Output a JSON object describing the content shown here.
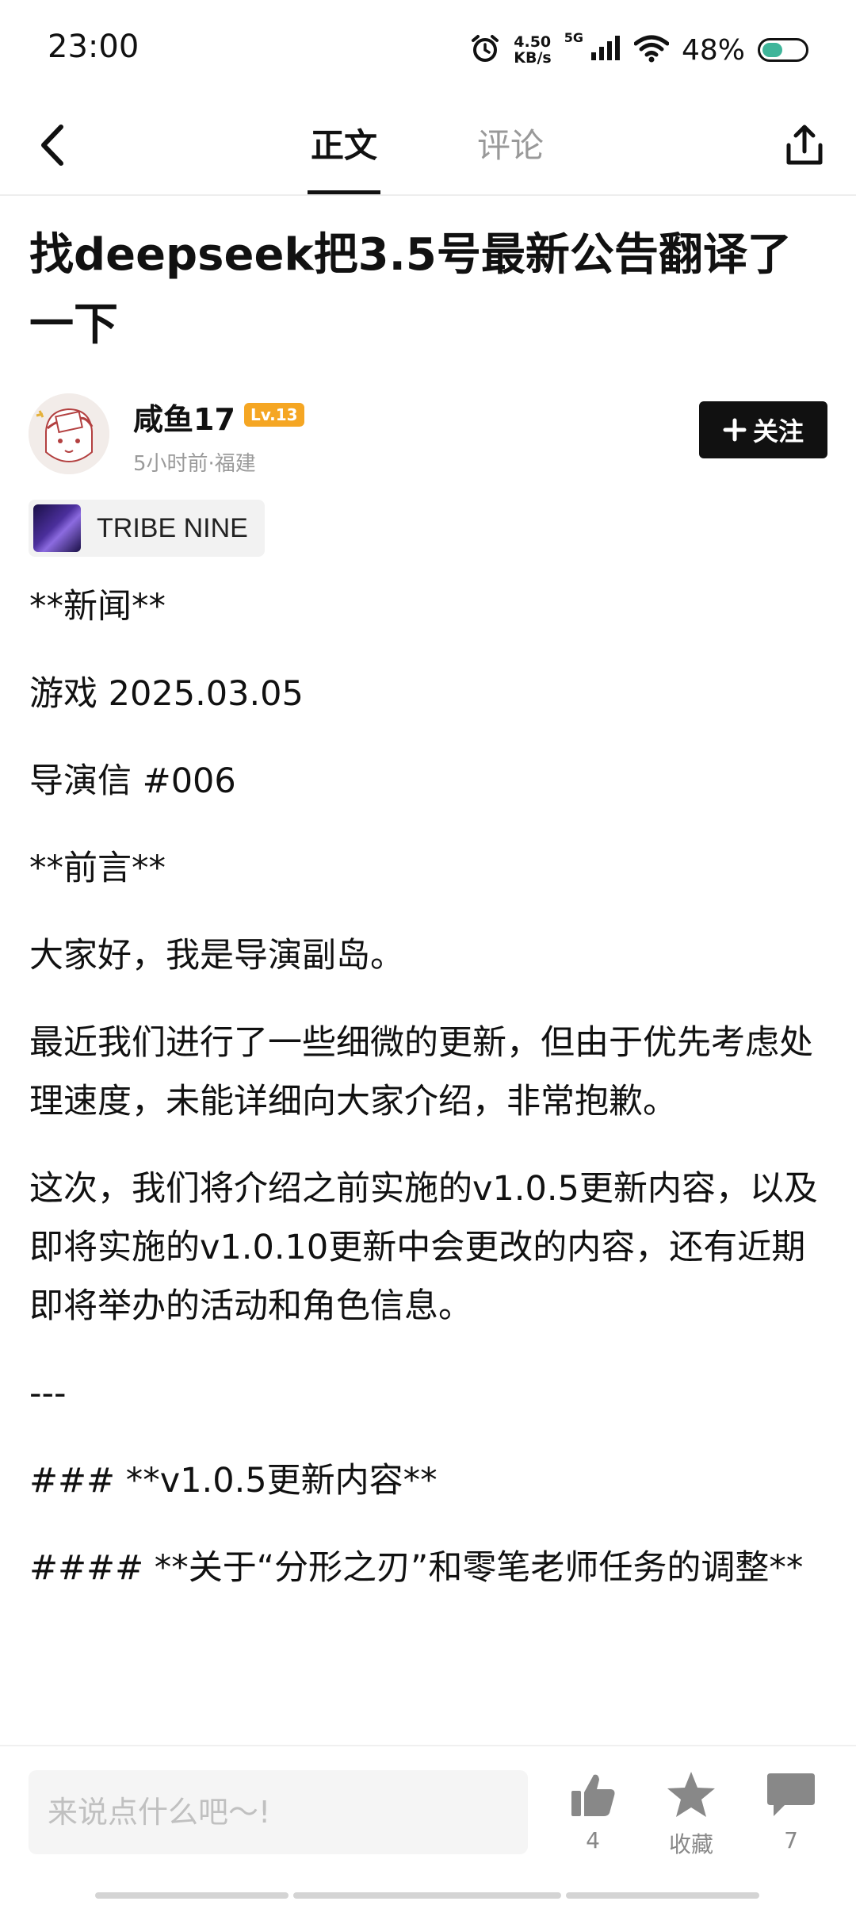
{
  "status": {
    "time": "23:00",
    "speed_value": "4.50",
    "speed_unit": "KB/s",
    "network": "5G",
    "battery": "48%",
    "battery_level": 0.48
  },
  "nav": {
    "tab_article": "正文",
    "tab_comments": "评论",
    "active_tab": "正文"
  },
  "post": {
    "title": "找deepseek把3.5号最新公告翻译了一下",
    "author": {
      "name": "咸鱼17",
      "level": "Lv.13",
      "meta": "5小时前·福建",
      "follow_label": "关注"
    },
    "tag": "TRIBE NINE",
    "paragraphs": [
      "**新闻**",
      "游戏 2025.03.05",
      "导演信 #006",
      "**前言**",
      "大家好，我是导演副岛。",
      "最近我们进行了一些细微的更新，但由于优先考虑处理速度，未能详细向大家介绍，非常抱歉。",
      "这次，我们将介绍之前实施的v1.0.5更新内容，以及即将实施的v1.0.10更新中会更改的内容，还有近期即将举办的活动和角色信息。",
      "---",
      "### **v1.0.5更新内容**",
      "#### **关于“分形之刃”和零笔老师任务的调整**"
    ]
  },
  "bottom": {
    "input_placeholder": "来说点什么吧～!",
    "like_count": "4",
    "favorite_label": "收藏",
    "comment_count": "7"
  },
  "colors": {
    "accent": "#111111",
    "level_badge": "#f5a623",
    "muted": "#999999",
    "battery_fill": "#3fb59a"
  }
}
